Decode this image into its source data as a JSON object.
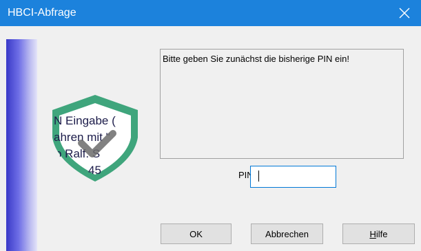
{
  "window": {
    "title": "HBCI-Abfrage",
    "close_icon": "close-icon",
    "title_color": "#1c82dc"
  },
  "shield": {
    "icon": "shield-check-icon",
    "color": "#3fa57c",
    "lines": [
      "N Eingabe (",
      "ahren mit \"",
      "o Ralf. S",
      "45"
    ]
  },
  "message": {
    "text": "Bitte geben Sie zunächst die bisherige PIN ein!"
  },
  "pin": {
    "label": "PIN",
    "value": ""
  },
  "buttons": {
    "ok": "OK",
    "cancel": "Abbrechen",
    "help_mnemonic": "H",
    "help_rest": "ilfe"
  }
}
